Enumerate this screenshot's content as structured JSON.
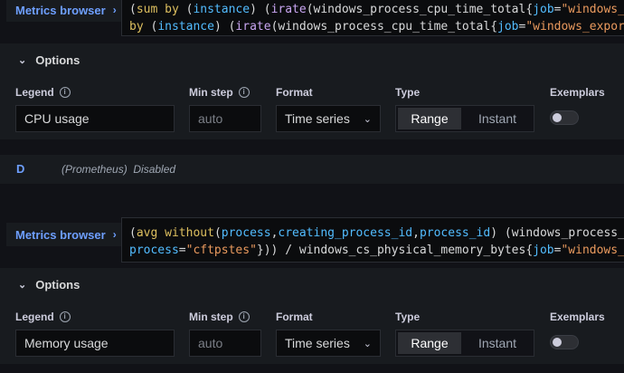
{
  "query1": {
    "metrics_browser": "Metrics browser",
    "line1": {
      "t1": "(",
      "t2": "sum",
      "t3": " ",
      "t4": "by",
      "t5": " (",
      "t6": "instance",
      "t7": ") (",
      "t8": "irate",
      "t9": "(",
      "t10": "windows_process_cpu_time_total",
      "t11": "{",
      "t12": "job",
      "t13": "=",
      "t14": "\"windows_e"
    },
    "line2": {
      "t1": "by",
      "t2": " (",
      "t3": "instance",
      "t4": ") (",
      "t5": "irate",
      "t6": "(",
      "t7": "windows_process_cpu_time_total",
      "t8": "{",
      "t9": "job",
      "t10": "=",
      "t11": "\"windows_export"
    },
    "options": {
      "header": "Options",
      "legend_label": "Legend",
      "legend_value": "CPU usage",
      "minstep_label": "Min step",
      "minstep_placeholder": "auto",
      "format_label": "Format",
      "format_value": "Time series",
      "type_label": "Type",
      "type_range": "Range",
      "type_instant": "Instant",
      "exemplars_label": "Exemplars"
    }
  },
  "query_d": {
    "letter": "D",
    "datasource": "(Prometheus)",
    "status": "Disabled"
  },
  "query2": {
    "metrics_browser": "Metrics browser",
    "line1": {
      "t1": "(",
      "t2": "avg",
      "t3": " ",
      "t4": "without",
      "t5": "(",
      "t6": "process",
      "t7": ",",
      "t8": "creating_process_id",
      "t9": ",",
      "t10": "process_id",
      "t11": ") (",
      "t12": "windows_process_w"
    },
    "line2": {
      "t1": "process",
      "t2": "=",
      "t3": "\"cftpstes\"",
      "t4": "})) / ",
      "t5": "windows_cs_physical_memory_bytes",
      "t6": "{",
      "t7": "job",
      "t8": "=",
      "t9": "\"windows_e"
    },
    "options": {
      "header": "Options",
      "legend_label": "Legend",
      "legend_value": "Memory usage",
      "minstep_label": "Min step",
      "minstep_placeholder": "auto",
      "format_label": "Format",
      "format_value": "Time series",
      "type_label": "Type",
      "type_range": "Range",
      "type_instant": "Instant",
      "exemplars_label": "Exemplars"
    }
  },
  "colors": {
    "background": "#111217",
    "panel": "#181b1f",
    "link_blue": "#6e9fff",
    "keyword_yellow": "#ddbf5f",
    "function_purple": "#c9a6f2",
    "label_blue": "#52bcff",
    "string_orange": "#ea9a5e"
  },
  "icons": {
    "chevron_right": "chevron-right-icon",
    "caret_down": "caret-down-icon",
    "info": "info-circle-icon"
  }
}
